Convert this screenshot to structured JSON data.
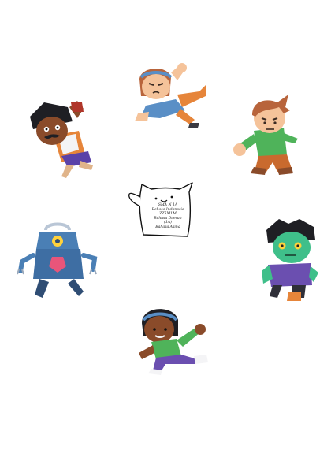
{
  "palette": {
    "skin_light": "#f5c39a",
    "skin_tan": "#e59c68",
    "skin_dark": "#8a4b2a",
    "skin_zombie": "#3fbf8a",
    "hair_brown": "#b8643b",
    "hair_black": "#1f1f24",
    "shirt_blue": "#5a8fc6",
    "shirt_green": "#4fb35a",
    "shirt_purple": "#6b4fb0",
    "pants_orange": "#e6853a",
    "robot_blue": "#4a7fb5",
    "robot_gem": "#e8557a",
    "robot_eye": "#ffd23c",
    "outline": "#111111"
  },
  "center_note": {
    "lines": [
      "SMA N 1A",
      "Bahasa Indonesia",
      "ZZ5M1M",
      "Bahasa Daerah",
      "(1A)",
      "Bahasa Asing"
    ]
  },
  "characters": [
    {
      "id": "girl-headband",
      "icon": "character-girl-icon"
    },
    {
      "id": "boy-mustache",
      "icon": "character-mustache-boy-icon"
    },
    {
      "id": "boy-ginger",
      "icon": "character-ginger-boy-icon"
    },
    {
      "id": "robot",
      "icon": "character-robot-icon"
    },
    {
      "id": "zombie",
      "icon": "character-zombie-icon"
    },
    {
      "id": "girl-running",
      "icon": "character-running-girl-icon"
    }
  ]
}
